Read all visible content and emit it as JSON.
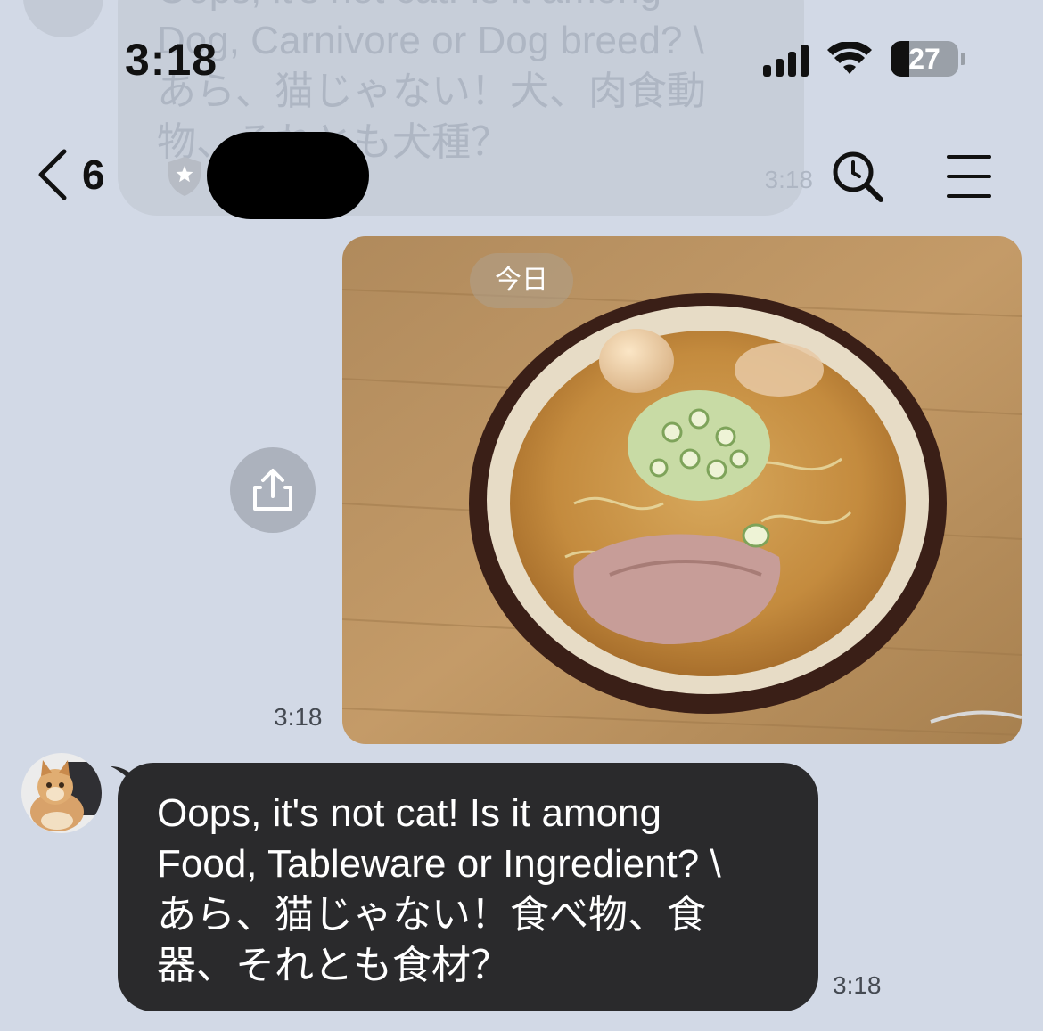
{
  "status_bar": {
    "time": "3:18",
    "battery": "27",
    "battery_level_percent": 27
  },
  "header": {
    "back_count": "6"
  },
  "ghost_message": {
    "lines": [
      "Oops, it's not cat! Is it among",
      "Dog, Carnivore or Dog breed? \\",
      "あら、猫じゃない！犬、肉食動",
      "物、それとも犬種？"
    ],
    "time": "3:18"
  },
  "photo_message": {
    "date_chip": "今日",
    "time": "3:18"
  },
  "incoming_message": {
    "lines": [
      "Oops, it's not cat! Is it among",
      "Food, Tableware or Ingredient? \\",
      "あら、猫じゃない！食べ物、食",
      "器、それとも食材？"
    ],
    "time": "3:18"
  },
  "colors": {
    "background": "#d2d9e6",
    "bubble": "#2a2a2c",
    "bubble_text": "#ffffff",
    "timestamp": "#454a52"
  }
}
